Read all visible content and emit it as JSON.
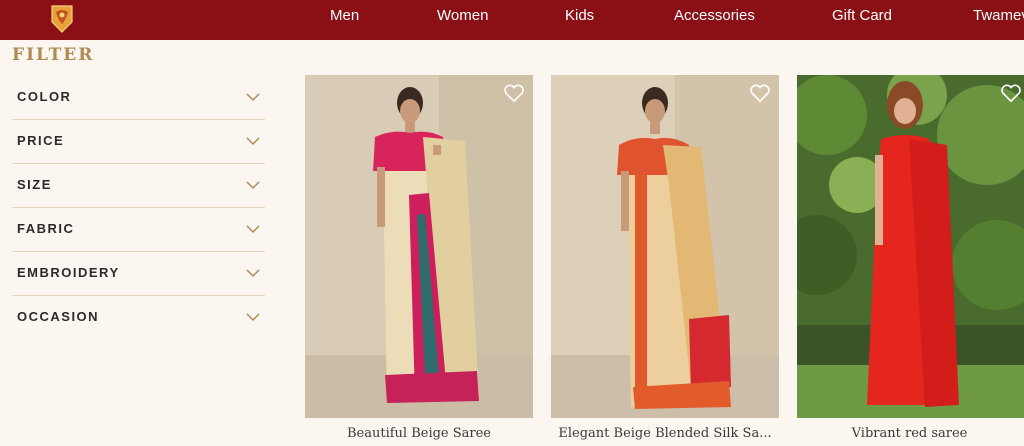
{
  "nav": {
    "items": [
      {
        "label": "Men"
      },
      {
        "label": "Women"
      },
      {
        "label": "Kids"
      },
      {
        "label": "Accessories"
      },
      {
        "label": "Gift Card"
      },
      {
        "label": "Twamev"
      }
    ]
  },
  "filter": {
    "title": "FILTER",
    "items": [
      {
        "label": "COLOR"
      },
      {
        "label": "PRICE"
      },
      {
        "label": "SIZE"
      },
      {
        "label": "FABRIC"
      },
      {
        "label": "EMBROIDERY"
      },
      {
        "label": "OCCASION"
      }
    ]
  },
  "products": [
    {
      "title": "Beautiful Beige Saree"
    },
    {
      "title": "Elegant Beige Blended Silk Sa..."
    },
    {
      "title": "Vibrant red saree"
    }
  ],
  "colors": {
    "nav_bg": "#8b1016",
    "accent_gold": "#b08a4e",
    "page_bg": "#fbf7f0"
  },
  "icons": {
    "logo": "brand-logo-icon",
    "chevron": "chevron-down-icon",
    "wishlist": "heart-icon"
  }
}
